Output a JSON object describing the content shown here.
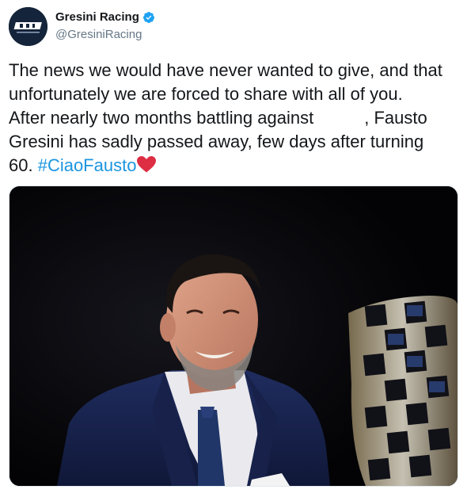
{
  "account": {
    "display_name": "Gresini Racing",
    "handle": "@GresiniRacing",
    "verified_icon": "verified-badge-icon",
    "avatar_logo_text": "GRESINI RACING",
    "avatar_bg": "#14243a"
  },
  "tweet": {
    "text_lines": [
      "The news we would have never wanted to give, and that",
      "unfortunately we are forced to share with all of you.",
      "After nearly two months battling against",
      ", Fausto",
      "Gresini has sadly passed away, few days after turning",
      "60. "
    ],
    "hashtag": "#CiaoFausto",
    "emoji_icon": "red-heart-icon",
    "hashtag_color": "#1b95e0",
    "text_color": "#14171a"
  },
  "media": {
    "image_icon": "photo-man-smiling-with-trophy",
    "background": "#050508"
  }
}
